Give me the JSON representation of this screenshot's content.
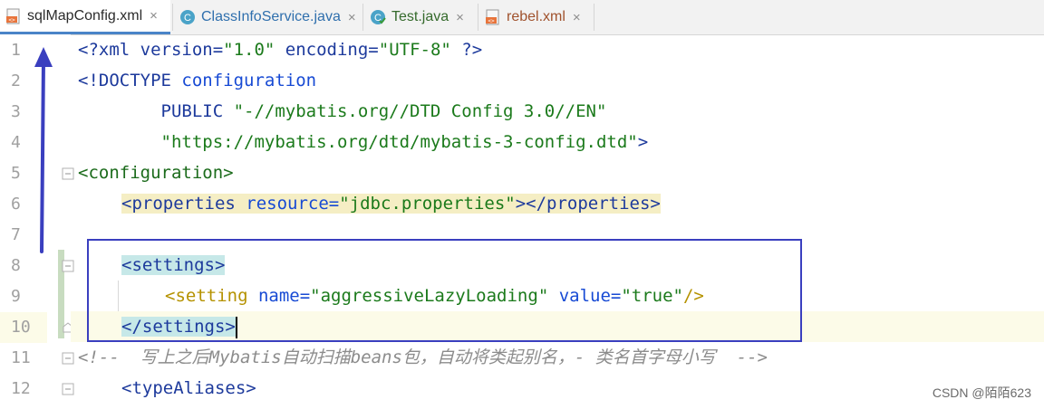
{
  "tabs": [
    {
      "label": "sqlMapConfig.xml",
      "icon": "xml-file-icon",
      "active": true
    },
    {
      "label": "ClassInfoService.java",
      "icon": "java-class-icon",
      "active": false
    },
    {
      "label": "Test.java",
      "icon": "java-test-icon",
      "active": false
    },
    {
      "label": "rebel.xml",
      "icon": "xml-file-icon",
      "active": false
    }
  ],
  "close_glyph": "×",
  "line_numbers": [
    "1",
    "2",
    "3",
    "4",
    "5",
    "6",
    "7",
    "8",
    "9",
    "10",
    "11",
    "12"
  ],
  "code": {
    "l1": {
      "a": "<?xml version=",
      "b": "\"1.0\"",
      "c": " encoding=",
      "d": "\"UTF-8\"",
      "e": " ?>"
    },
    "l2": {
      "a": "<!DOCTYPE ",
      "b": "configuration"
    },
    "l3": {
      "a": "        PUBLIC ",
      "b": "\"-//mybatis.org//DTD Config 3.0//EN\""
    },
    "l4": {
      "a": "        ",
      "b": "\"https://mybatis.org/dtd/mybatis-3-config.dtd\"",
      "c": ">"
    },
    "l5": {
      "a": "<configuration>"
    },
    "l6": {
      "a": "<properties ",
      "b": "resource=",
      "c": "\"jdbc.properties\"",
      "d": "></properties>"
    },
    "l8": {
      "a": "<settings>"
    },
    "l9": {
      "a": "<setting ",
      "b": "name=",
      "c": "\"aggressiveLazyLoading\"",
      "d": " value=",
      "e": "\"true\"",
      "f": "/>"
    },
    "l10": {
      "a": "</settings>"
    },
    "l11": {
      "a": "<!--  写上之后Mybatis自动扫描beans包，自动将类起别名，- 类名首字母小写  -->"
    },
    "l12": {
      "a": "<typeAliases>"
    }
  },
  "watermark": "CSDN @陌陌623",
  "colors": {
    "annotation": "#3a3fbf",
    "tab_active_underline": "#4a84c8"
  }
}
